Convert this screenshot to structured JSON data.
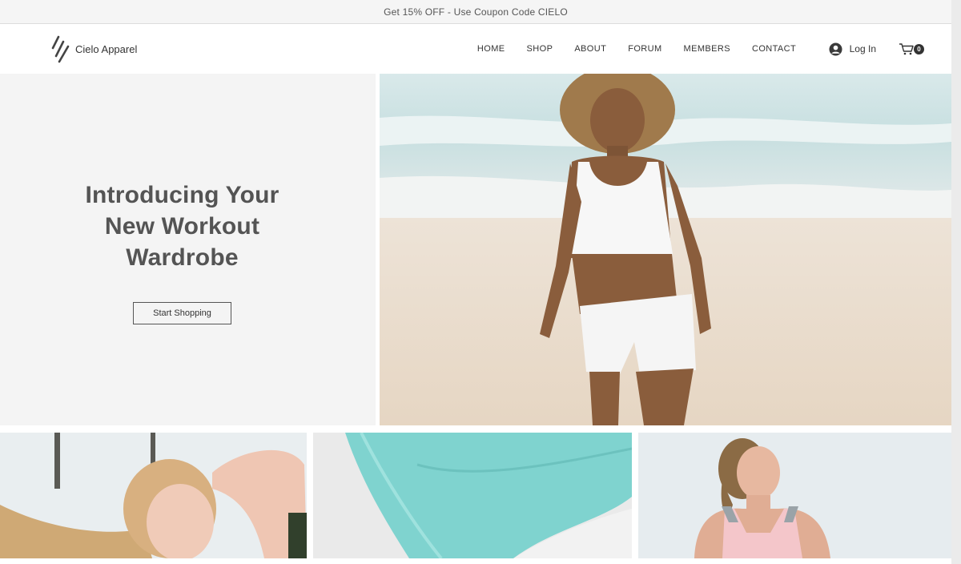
{
  "promo": {
    "text": "Get 15% OFF - Use Coupon Code CIELO"
  },
  "brand": {
    "name": "Cielo Apparel"
  },
  "nav": {
    "items": [
      {
        "label": "HOME"
      },
      {
        "label": "SHOP"
      },
      {
        "label": "ABOUT"
      },
      {
        "label": "FORUM"
      },
      {
        "label": "MEMBERS"
      },
      {
        "label": "CONTACT"
      }
    ]
  },
  "account": {
    "login_label": "Log In"
  },
  "cart": {
    "count": "0"
  },
  "hero": {
    "title_line1": "Introducing Your",
    "title_line2": "New Workout",
    "title_line3": "Wardrobe",
    "cta_label": "Start Shopping"
  },
  "colors": {
    "accent_teal": "#7fd3cf",
    "text_dark": "#545454",
    "hero_panel_bg": "#f4f4f4"
  },
  "icons": {
    "logo": "diagonal-stripes-logo-icon",
    "login": "user-avatar-icon",
    "cart": "shopping-cart-icon"
  }
}
